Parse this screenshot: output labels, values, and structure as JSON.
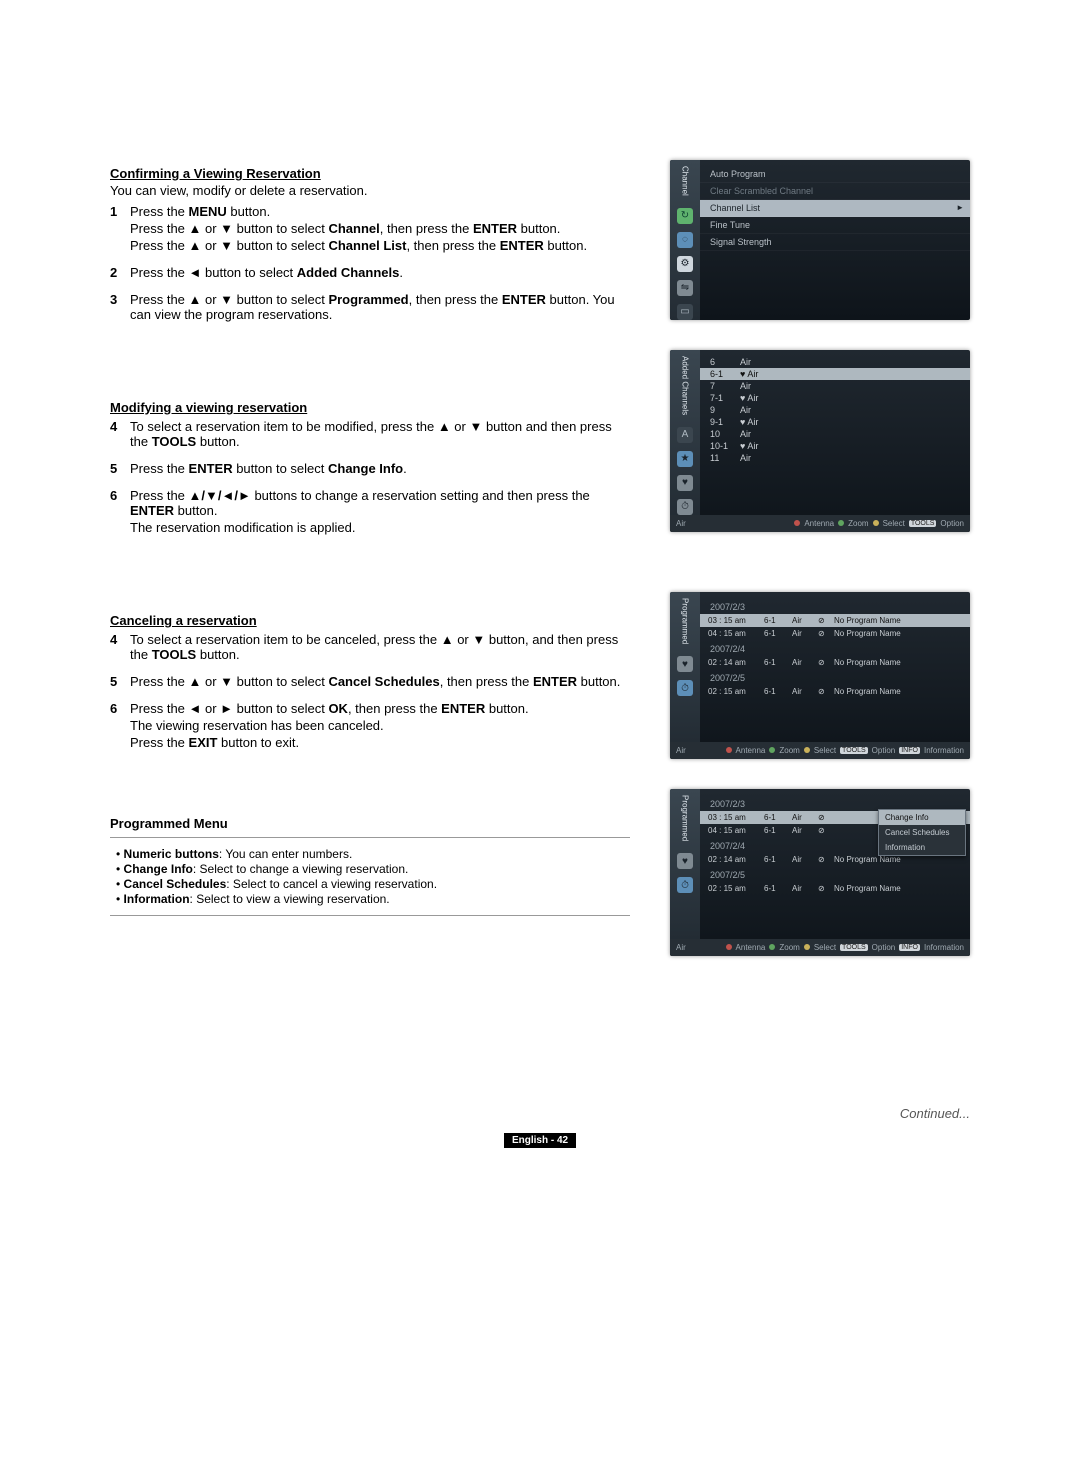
{
  "section1": {
    "title": "Confirming a Viewing Reservation",
    "intro": "You can view, modify or delete a reservation.",
    "steps": [
      {
        "n": "1",
        "lines": [
          "Press the <b>MENU</b> button.",
          "Press the ▲ or ▼ button to select <b>Channel</b>, then press the <b>ENTER</b> button.",
          "Press the ▲ or ▼ button to select <b>Channel List</b>, then press the <b>ENTER</b> button."
        ]
      },
      {
        "n": "2",
        "lines": [
          "Press the ◄ button to select <b>Added Channels</b>."
        ]
      },
      {
        "n": "3",
        "lines": [
          "Press the ▲ or ▼ button to select <b>Programmed</b>, then press the <b>ENTER</b> button. You can view the program reservations."
        ]
      }
    ]
  },
  "section2": {
    "title": "Modifying a viewing reservation",
    "steps": [
      {
        "n": "4",
        "lines": [
          "To select a reservation item to be modified, press the ▲ or ▼ button and then press the <b>TOOLS</b> button."
        ]
      },
      {
        "n": "5",
        "lines": [
          "Press the <b>ENTER</b> button to select <b>Change Info</b>."
        ]
      },
      {
        "n": "6",
        "lines": [
          "Press the <b>▲/▼/◄/►</b> buttons to change a reservation setting and then press the <b>ENTER</b> button.",
          "The reservation modification is applied."
        ]
      }
    ]
  },
  "section3": {
    "title": "Canceling a reservation",
    "steps": [
      {
        "n": "4",
        "lines": [
          "To select a reservation item to be canceled, press the ▲ or ▼ button, and then press the <b>TOOLS</b> button."
        ]
      },
      {
        "n": "5",
        "lines": [
          "Press the ▲ or ▼ button to select <b>Cancel Schedules</b>, then press the <b>ENTER</b> button."
        ]
      },
      {
        "n": "6",
        "lines": [
          "Press the ◄ or ► button to select <b>OK</b>, then press the <b>ENTER</b> button.",
          "The viewing reservation has been canceled.",
          "Press the <b>EXIT</b> button to exit."
        ]
      }
    ]
  },
  "pm": {
    "title": "Programmed Menu",
    "items": [
      {
        "k": "Numeric buttons",
        "v": "You can enter numbers."
      },
      {
        "k": "Change Info",
        "v": "Select to change a viewing reservation."
      },
      {
        "k": "Cancel Schedules",
        "v": "Select to cancel a viewing reservation."
      },
      {
        "k": "Information",
        "v": "Select to view a viewing reservation."
      }
    ]
  },
  "tv1": {
    "side": "Channel",
    "items": [
      {
        "t": "Auto Program"
      },
      {
        "t": "Clear Scrambled Channel",
        "dim": true
      },
      {
        "t": "Channel List",
        "sel": true
      },
      {
        "t": "Fine Tune"
      },
      {
        "t": "Signal Strength"
      }
    ]
  },
  "tv2": {
    "side": "Added Channels",
    "rows": [
      {
        "c": "6",
        "t": "Air"
      },
      {
        "c": "6-1",
        "t": "♥ Air",
        "sel": true
      },
      {
        "c": "7",
        "t": "Air"
      },
      {
        "c": "7-1",
        "t": "♥ Air"
      },
      {
        "c": "9",
        "t": "Air"
      },
      {
        "c": "9-1",
        "t": "♥ Air"
      },
      {
        "c": "10",
        "t": "Air"
      },
      {
        "c": "10-1",
        "t": "♥ Air"
      },
      {
        "c": "11",
        "t": "Air"
      }
    ],
    "foot": {
      "left": "Air",
      "antenna": "Antenna",
      "zoom": "Zoom",
      "select": "Select",
      "opt": "Option"
    }
  },
  "tv3": {
    "side": "Programmed",
    "date1": "2007/2/3",
    "rows": [
      {
        "t": "03 : 15  am",
        "ch": "6-1",
        "a": "Air",
        "nm": "No Program Name",
        "sel": true
      },
      {
        "t": "04 : 15  am",
        "ch": "6-1",
        "a": "Air",
        "nm": "No Program Name"
      }
    ],
    "date2": "2007/2/4",
    "rows2": [
      {
        "t": "02 : 14  am",
        "ch": "6-1",
        "a": "Air",
        "nm": "No Program Name"
      }
    ],
    "date3": "2007/2/5",
    "rows3": [
      {
        "t": "02 : 15  am",
        "ch": "6-1",
        "a": "Air",
        "nm": "No Program Name"
      }
    ],
    "foot": {
      "left": "Air",
      "antenna": "Antenna",
      "zoom": "Zoom",
      "select": "Select",
      "opt": "Option",
      "info": "Information"
    }
  },
  "tv4": {
    "side": "Programmed",
    "date1": "2007/2/3",
    "rows": [
      {
        "t": "03 : 15  am",
        "ch": "6-1",
        "a": "Air",
        "nm": "",
        "sel": true
      },
      {
        "t": "04 : 15  am",
        "ch": "6-1",
        "a": "Air",
        "nm": ""
      }
    ],
    "date2": "2007/2/4",
    "rows2": [
      {
        "t": "02 : 14  am",
        "ch": "6-1",
        "a": "Air",
        "nm": "No Program Name"
      }
    ],
    "date3": "2007/2/5",
    "rows3": [
      {
        "t": "02 : 15  am",
        "ch": "6-1",
        "a": "Air",
        "nm": "No Program Name"
      }
    ],
    "ctx": [
      "Change Info",
      "Cancel Schedules",
      "Information"
    ],
    "foot": {
      "left": "Air",
      "antenna": "Antenna",
      "zoom": "Zoom",
      "select": "Select",
      "opt": "Option",
      "info": "Information"
    }
  },
  "continued": "Continued...",
  "pagelabel": "English - 42"
}
